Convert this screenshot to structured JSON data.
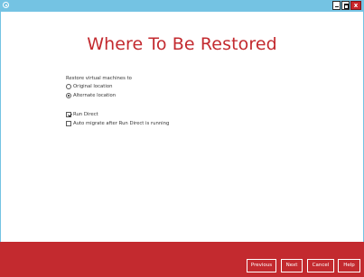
{
  "window": {
    "close_glyph": "x"
  },
  "page": {
    "title": "Where To Be Restored"
  },
  "restore": {
    "label": "Restore virtual machines to",
    "options": [
      {
        "label": "Original location",
        "selected": false
      },
      {
        "label": "Alternate location",
        "selected": true
      }
    ]
  },
  "checkboxes": [
    {
      "label": "Run Direct",
      "checked": true
    },
    {
      "label": "Auto migrate after Run Direct is running",
      "checked": false
    }
  ],
  "footer": {
    "buttons": [
      "Previous",
      "Next",
      "Cancel",
      "Help"
    ]
  },
  "colors": {
    "titlebar": "#74c3e3",
    "accent_red": "#c32a2f"
  },
  "icons": {
    "app": "app-icon",
    "minimize": "minimize-icon",
    "maximize": "maximize-icon",
    "close": "close-icon"
  }
}
